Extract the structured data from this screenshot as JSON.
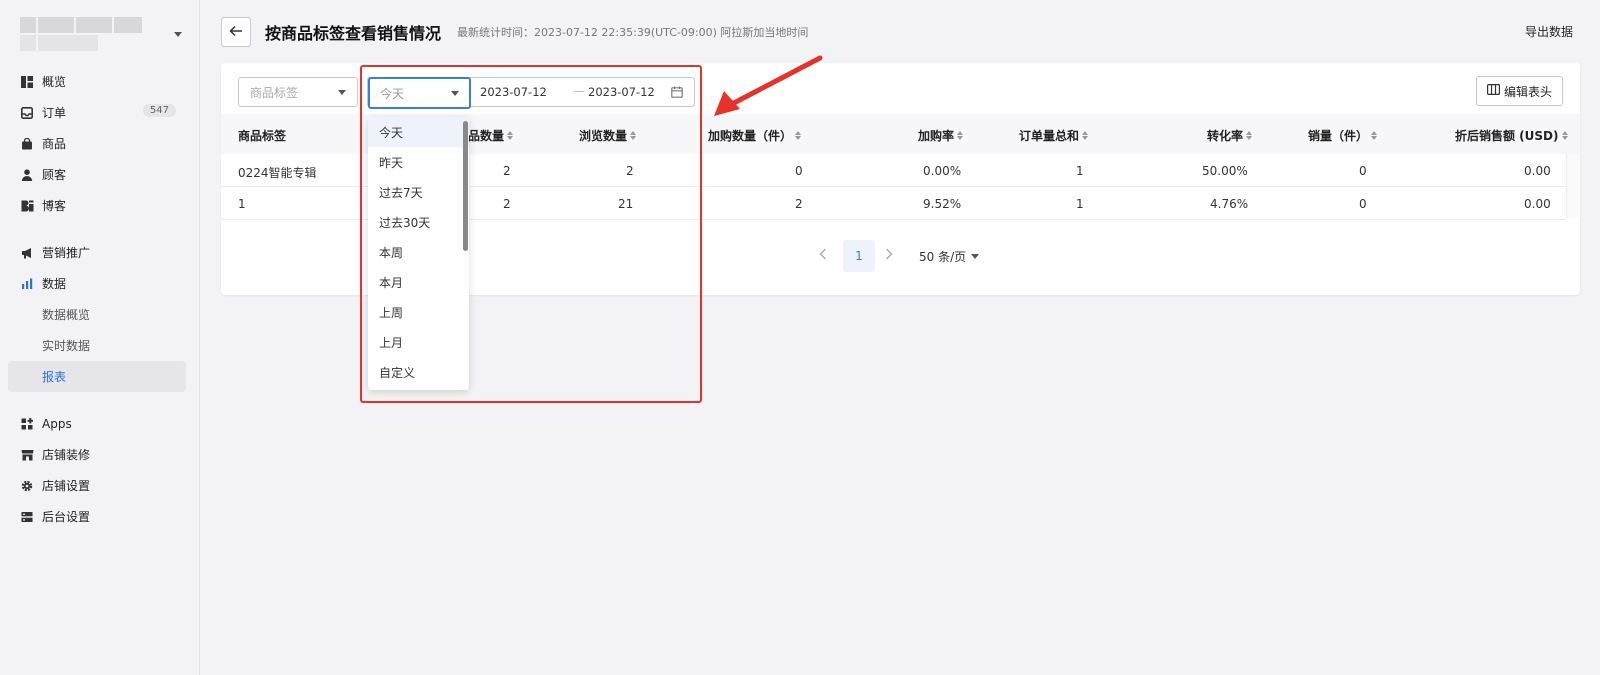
{
  "sidebar": {
    "items": [
      {
        "label": "概览",
        "icon": "dashboard-icon"
      },
      {
        "label": "订单",
        "icon": "inbox-icon",
        "badge": "547"
      },
      {
        "label": "商品",
        "icon": "bag-icon"
      },
      {
        "label": "顾客",
        "icon": "user-icon"
      },
      {
        "label": "博客",
        "icon": "blog-icon"
      },
      {
        "label": "营销推广",
        "icon": "megaphone-icon"
      },
      {
        "label": "数据",
        "icon": "bar-chart-icon"
      },
      {
        "label": "数据概览"
      },
      {
        "label": "实时数据"
      },
      {
        "label": "报表"
      },
      {
        "label": "Apps",
        "icon": "apps-icon"
      },
      {
        "label": "店铺装修",
        "icon": "storefront-icon"
      },
      {
        "label": "店铺设置",
        "icon": "gear-icon"
      },
      {
        "label": "后台设置",
        "icon": "server-icon"
      }
    ]
  },
  "header": {
    "title": "按商品标签查看销售情况",
    "stat_time": "最新统计时间：2023-07-12 22:35:39(UTC-09:00) 阿拉斯加当地时间",
    "export_label": "导出数据"
  },
  "filters": {
    "tag_placeholder": "商品标签",
    "range_value": "今天",
    "date_start": "2023-07-12",
    "date_end": "2023-07-12",
    "edit_columns_label": "编辑表头"
  },
  "table": {
    "headers": [
      "商品标签",
      "品数量",
      "浏览数量",
      "加购数量（件）",
      "加购率",
      "订单量总和",
      "转化率",
      "销量（件）",
      "折后销售额 (USD)"
    ],
    "rows": [
      [
        "0224智能专辑",
        "2",
        "2",
        "0",
        "0.00%",
        "1",
        "50.00%",
        "0",
        "0.00"
      ],
      [
        "1",
        "2",
        "21",
        "2",
        "9.52%",
        "1",
        "4.76%",
        "0",
        "0.00"
      ]
    ]
  },
  "pagination": {
    "current_page": "1",
    "page_size": "50 条/页"
  },
  "dropdown": {
    "options": [
      "今天",
      "昨天",
      "过去7天",
      "过去30天",
      "本周",
      "本月",
      "上周",
      "上月",
      "自定义"
    ]
  },
  "colors": {
    "accent": "#3c7be0",
    "annotation": "#e8312b"
  }
}
